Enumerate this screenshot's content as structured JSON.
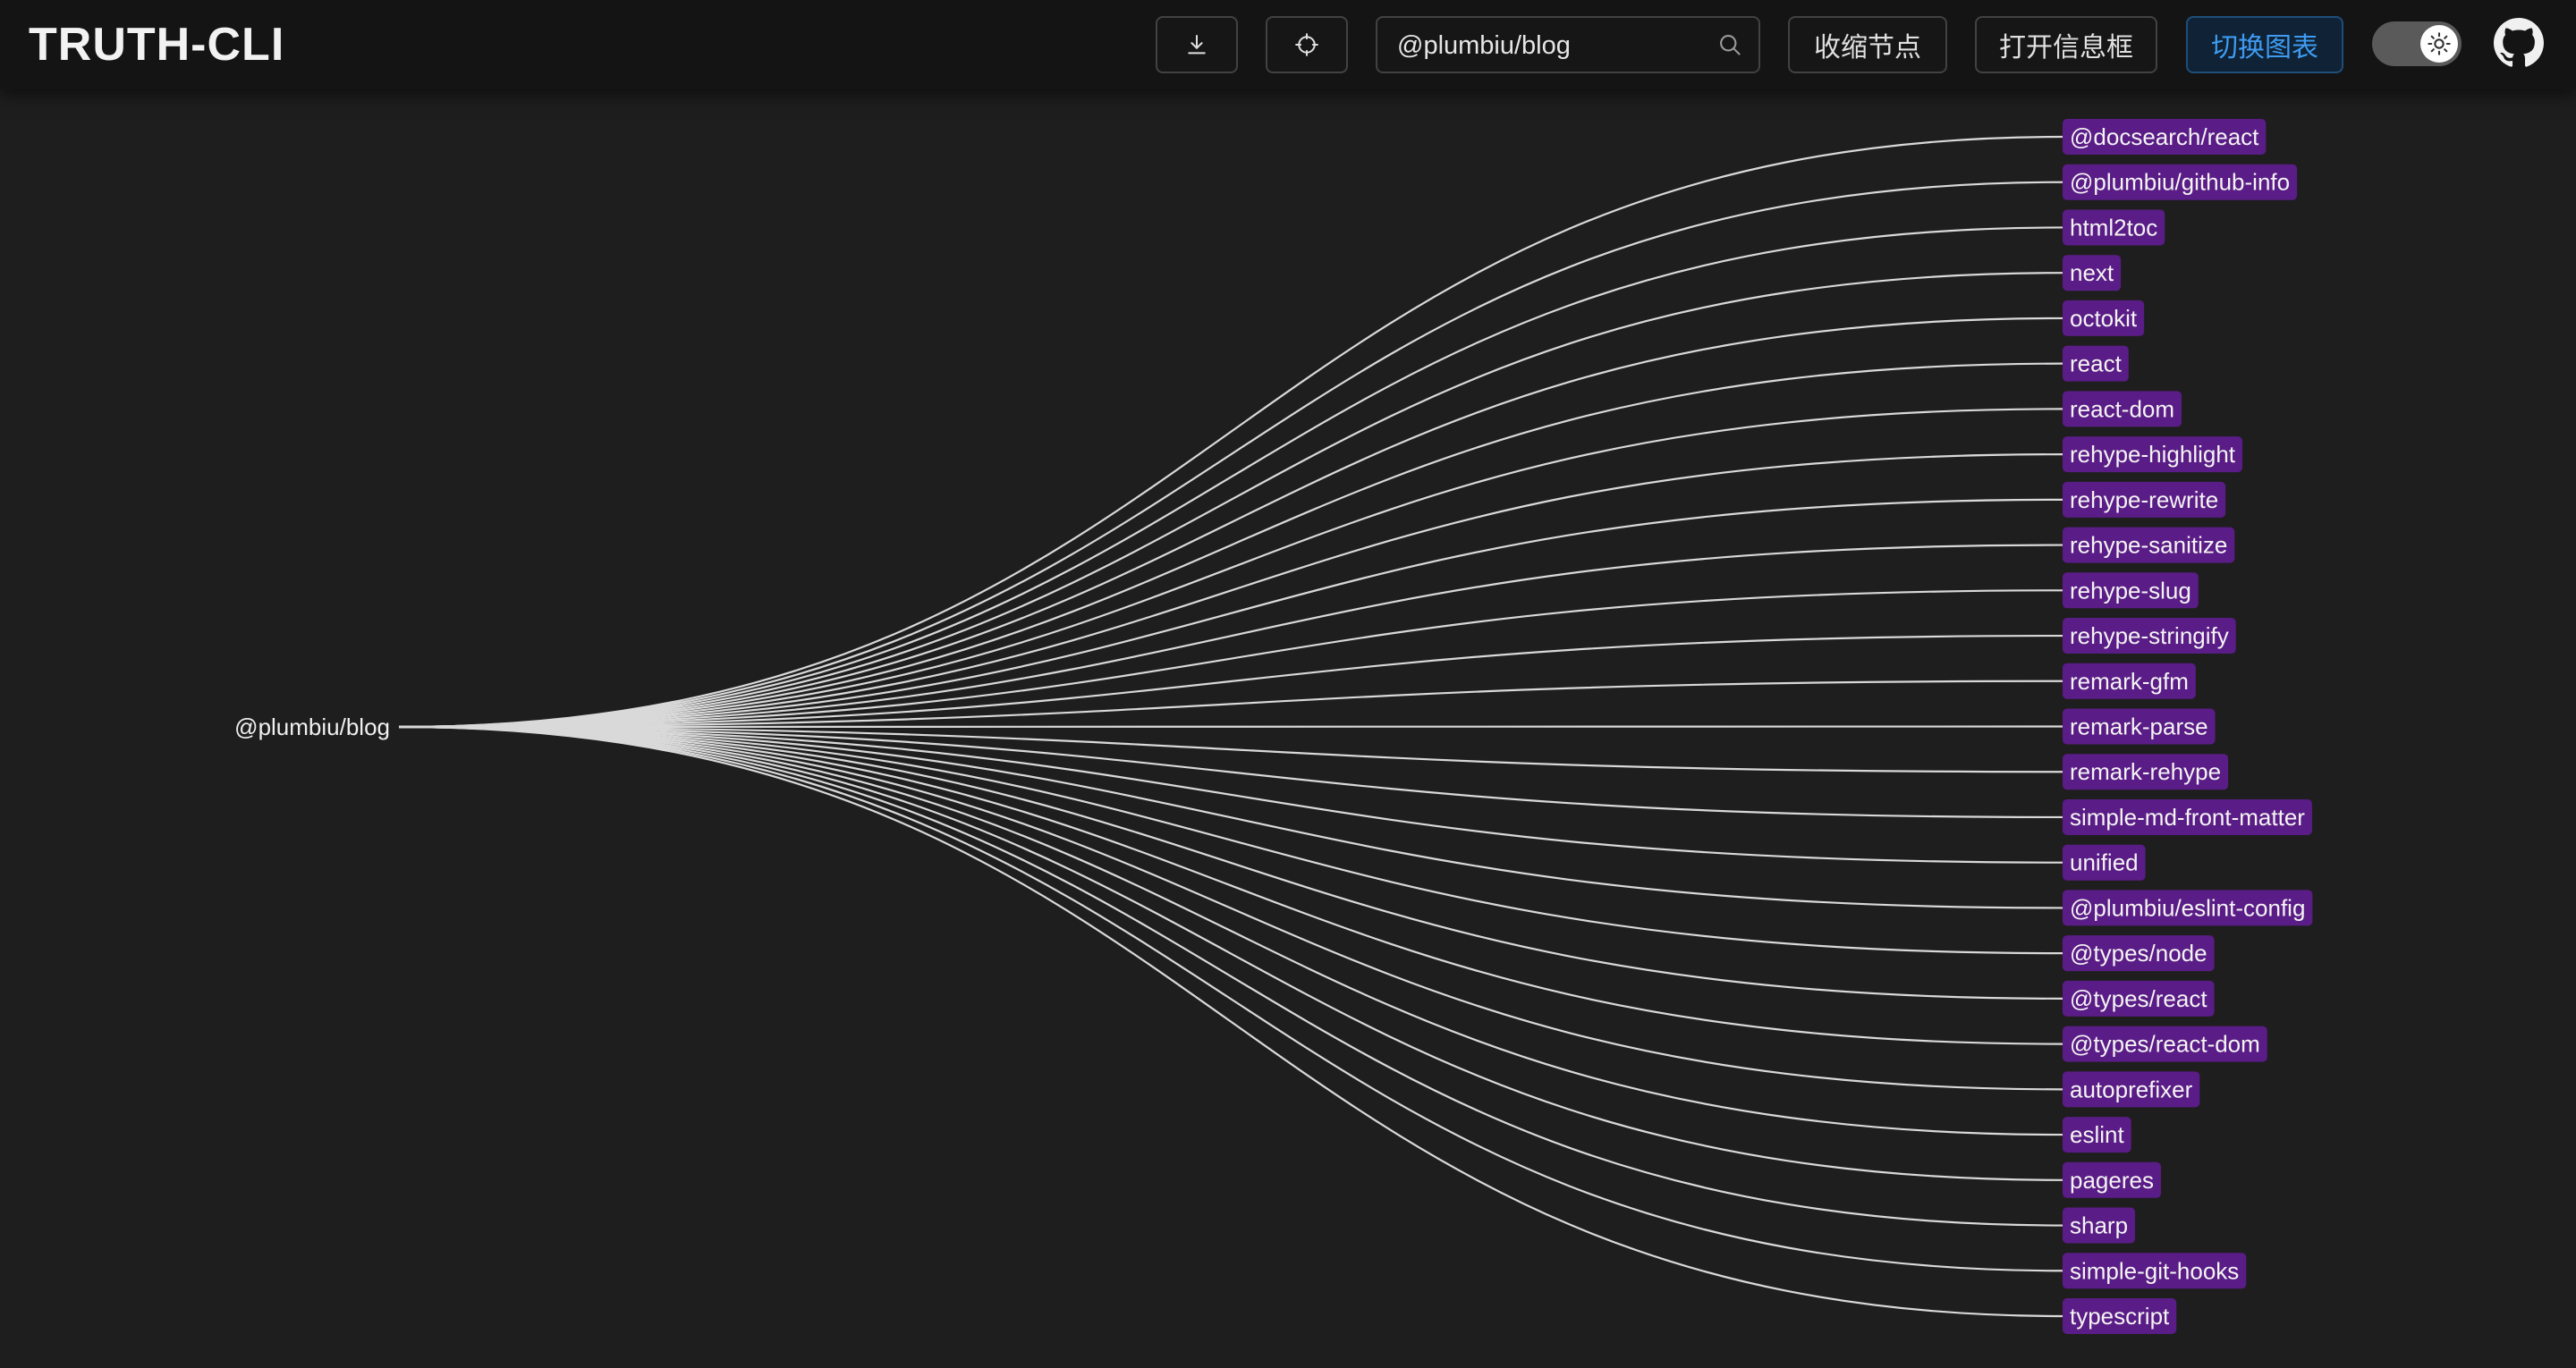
{
  "header": {
    "title": "TRUTH-CLI",
    "download_icon": "download-icon",
    "locate_icon": "locate-icon",
    "search": {
      "value": "@plumbiu/blog",
      "icon": "search-icon"
    },
    "collapse_label": "收缩节点",
    "open_info_label": "打开信息框",
    "switch_chart_label": "切换图表",
    "theme_toggle_icon": "sun-icon",
    "github_icon": "github-icon"
  },
  "graph": {
    "root": "@plumbiu/blog",
    "dependencies": [
      "@docsearch/react",
      "@plumbiu/github-info",
      "html2toc",
      "next",
      "octokit",
      "react",
      "react-dom",
      "rehype-highlight",
      "rehype-rewrite",
      "rehype-sanitize",
      "rehype-slug",
      "rehype-stringify",
      "remark-gfm",
      "remark-parse",
      "remark-rehype",
      "simple-md-front-matter",
      "unified",
      "@plumbiu/eslint-config",
      "@types/node",
      "@types/react",
      "@types/react-dom",
      "autoprefixer",
      "eslint",
      "pageres",
      "sharp",
      "simple-git-hooks",
      "typescript"
    ]
  },
  "colors": {
    "background": "#1e1e1e",
    "header": "#141414",
    "leaf_badge": "#5a1c86",
    "link": "#d9d9d9",
    "primary_text": "#3e9bf0"
  }
}
